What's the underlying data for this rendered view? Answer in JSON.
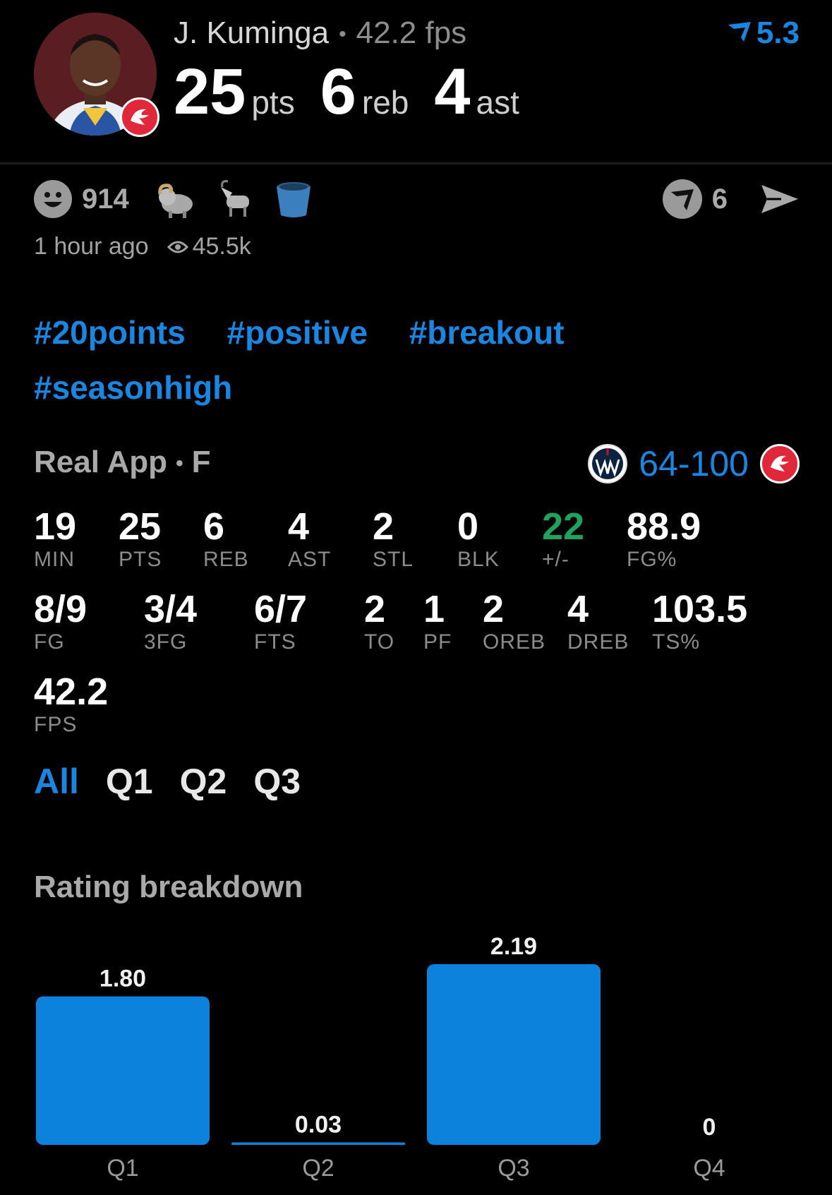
{
  "header": {
    "player_name": "J. Kuminga",
    "fps_text": "42.2 fps",
    "rating": "5.3",
    "stats": [
      {
        "value": "25",
        "label": "pts"
      },
      {
        "value": "6",
        "label": "reb"
      },
      {
        "value": "4",
        "label": "ast"
      }
    ]
  },
  "reactions": {
    "count": "914",
    "emojis": [
      "ram-icon",
      "goat-icon",
      "bucket-icon"
    ],
    "v_count": "6",
    "time": "1 hour ago",
    "views": "45.5k"
  },
  "tags": [
    "#20points",
    "#positive",
    "#breakout",
    "#seasonhigh"
  ],
  "game": {
    "source": "Real App",
    "position": "F",
    "score": "64-100"
  },
  "box_row1": [
    {
      "v": "19",
      "l": "MIN"
    },
    {
      "v": "25",
      "l": "PTS"
    },
    {
      "v": "6",
      "l": "REB"
    },
    {
      "v": "4",
      "l": "AST"
    },
    {
      "v": "2",
      "l": "STL"
    },
    {
      "v": "0",
      "l": "BLK"
    },
    {
      "v": "22",
      "l": "+/-"
    },
    {
      "v": "88.9",
      "l": "FG%"
    }
  ],
  "box_row2": [
    {
      "v": "8/9",
      "l": "FG"
    },
    {
      "v": "3/4",
      "l": "3FG"
    },
    {
      "v": "6/7",
      "l": "FTS"
    },
    {
      "v": "2",
      "l": "TO"
    },
    {
      "v": "1",
      "l": "PF"
    },
    {
      "v": "2",
      "l": "OREB"
    },
    {
      "v": "4",
      "l": "DREB"
    },
    {
      "v": "103.5",
      "l": "TS%"
    }
  ],
  "box_row3": [
    {
      "v": "42.2",
      "l": "FPS"
    }
  ],
  "quarter_tabs": [
    "All",
    "Q1",
    "Q2",
    "Q3"
  ],
  "section_title": "Rating breakdown",
  "colors": {
    "accent": "#1b86e0",
    "positive": "#1fa160",
    "bar": "#0c82dc"
  },
  "chart_data": {
    "type": "bar",
    "categories": [
      "Q1",
      "Q2",
      "Q3",
      "Q4"
    ],
    "values": [
      1.8,
      0.03,
      2.19,
      0
    ],
    "value_labels": [
      "1.80",
      "0.03",
      "2.19",
      "0"
    ],
    "title": "Rating breakdown",
    "xlabel": "",
    "ylabel": "",
    "ylim": [
      0,
      2.19
    ]
  }
}
